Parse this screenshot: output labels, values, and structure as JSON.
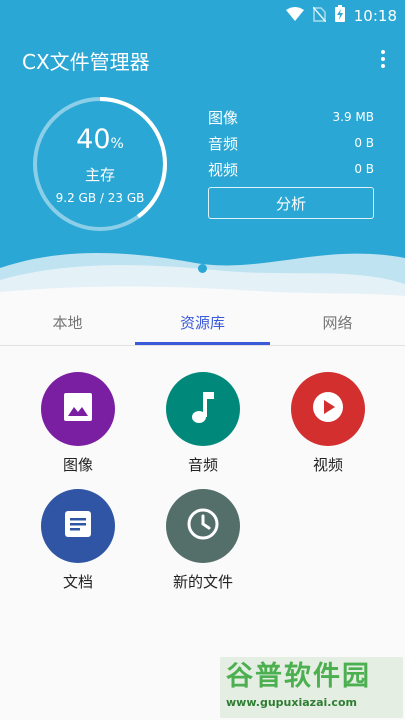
{
  "status_bar": {
    "time": "10:18"
  },
  "app": {
    "title": "CX文件管理器"
  },
  "storage": {
    "percent": "40",
    "percent_sign": "%",
    "percent_value": 40,
    "label": "主存",
    "size": "9.2 GB / 23 GB"
  },
  "stats": [
    {
      "label": "图像",
      "value": "3.9 MB"
    },
    {
      "label": "音频",
      "value": "0 B"
    },
    {
      "label": "视频",
      "value": "0 B"
    }
  ],
  "analyze_label": "分析",
  "tabs": [
    {
      "label": "本地",
      "active": false
    },
    {
      "label": "资源库",
      "active": true
    },
    {
      "label": "网络",
      "active": false
    }
  ],
  "library": [
    {
      "label": "图像",
      "icon": "image-icon",
      "color": "#7b1fa2"
    },
    {
      "label": "音频",
      "icon": "music-note-icon",
      "color": "#00897b"
    },
    {
      "label": "视频",
      "icon": "play-icon",
      "color": "#d32f2f"
    },
    {
      "label": "文档",
      "icon": "document-icon",
      "color": "#2f55a4"
    },
    {
      "label": "新的文件",
      "icon": "clock-icon",
      "color": "#546e6a"
    }
  ],
  "colors": {
    "header": "#2aa7d4",
    "accent": "#3a5bd9"
  },
  "watermark": {
    "title": "谷普软件园",
    "url": "www.gupuxiazai.com"
  }
}
